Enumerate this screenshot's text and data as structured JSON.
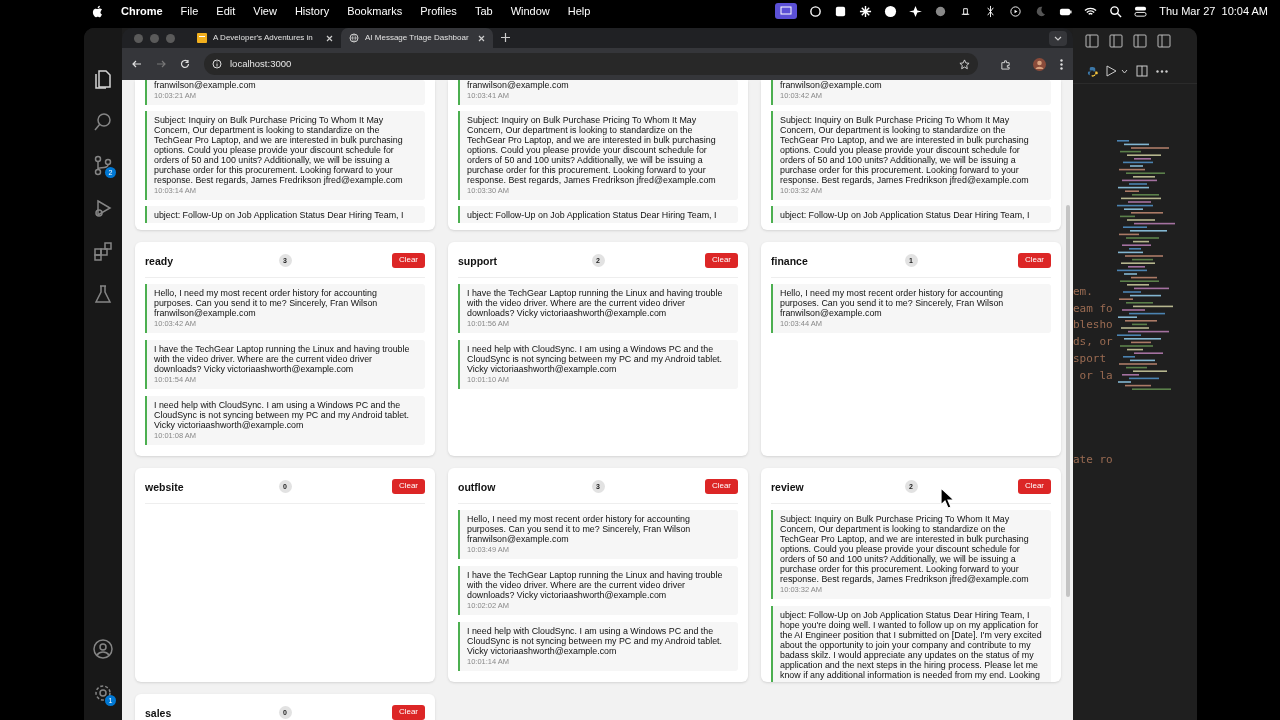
{
  "menubar": {
    "app": "Chrome",
    "menus": [
      "File",
      "Edit",
      "View",
      "History",
      "Bookmarks",
      "Profiles",
      "Tab",
      "Window",
      "Help"
    ],
    "clock": "Thu Mar 27  10:04 AM"
  },
  "vscode": {
    "source_control_badge": "2",
    "settings_badge": "1",
    "editor_lines": [
      "em.",
      "eam fo",
      "blesho",
      "ds, or",
      "sport",
      " or la"
    ],
    "editor_lines_lower": [
      "ate ro"
    ]
  },
  "browser": {
    "tabs": [
      {
        "title": "A Developer's Adventures in",
        "selected": false
      },
      {
        "title": "AI Message Triage Dashboar",
        "selected": true
      }
    ],
    "url": "localhost:3000"
  },
  "top_cards": [
    {
      "messages": [
        {
          "text": "franwilson@example.com",
          "time": "10:03:21 AM"
        },
        {
          "text": "Subject: Inquiry on Bulk Purchase Pricing To Whom It May Concern, Our department is looking to standardize on the TechGear Pro Laptop, and we are interested in bulk purchasing options. Could you please provide your discount schedule for orders of 50 and 100 units? Additionally, we will be issuing a purchase order for this procurement. Looking forward to your response. Best regards, James Fredrikson jfred@example.com",
          "time": "10:03:14 AM"
        },
        {
          "text": "ubject: Follow-Up on Job Application Status Dear Hiring Team, I"
        }
      ]
    },
    {
      "messages": [
        {
          "text": "franwilson@example.com",
          "time": "10:03:41 AM"
        },
        {
          "text": "Subject: Inquiry on Bulk Purchase Pricing To Whom It May Concern, Our department is looking to standardize on the TechGear Pro Laptop, and we are interested in bulk purchasing options. Could you please provide your discount schedule for orders of 50 and 100 units? Additionally, we will be issuing a purchase order for this procurement. Looking forward to your response. Best regards, James Fredrikson jfred@example.com",
          "time": "10:03:30 AM"
        },
        {
          "text": "ubject: Follow-Up on Job Application Status Dear Hiring Team, I"
        }
      ]
    },
    {
      "messages": [
        {
          "text": "franwilson@example.com",
          "time": "10:03:42 AM"
        },
        {
          "text": "Subject: Inquiry on Bulk Purchase Pricing To Whom It May Concern, Our department is looking to standardize on the TechGear Pro Laptop, and we are interested in bulk purchasing options. Could you please provide your discount schedule for orders of 50 and 100 units? Additionally, we will be issuing a purchase order for this procurement. Looking forward to your response. Best regards, James Fredrikson jfred@example.com",
          "time": "10:03:32 AM"
        },
        {
          "text": "ubject: Follow-Up on Job Application Status Dear Hiring Team, I"
        }
      ]
    }
  ],
  "cards": [
    {
      "title": "ready",
      "count": "3",
      "button": "Clear",
      "messages": [
        {
          "text": "Hello, I need my most recent order history for accounting purposes. Can you send it to me? Sincerely, Fran Wilson franwilson@example.com",
          "time": "10:03:42 AM"
        },
        {
          "text": "I have the TechGear Laptop running the Linux and having trouble with the video driver. Where are the current video driver downloads? Vicky victoriaashworth@example.com",
          "time": "10:01:54 AM"
        },
        {
          "text": "I need help with CloudSync. I am using a Windows PC and the CloudSync is not syncing between my PC and my Android tablet. Vicky victoriaashworth@example.com",
          "time": "10:01:08 AM"
        }
      ]
    },
    {
      "title": "support",
      "count": "2",
      "button": "Clear",
      "messages": [
        {
          "text": "I have the TechGear Laptop running the Linux and having trouble with the video driver. Where are the current video driver downloads? Vicky victoriaashworth@example.com",
          "time": "10:01:56 AM"
        },
        {
          "text": "I need help with CloudSync. I am using a Windows PC and the CloudSync is not syncing between my PC and my Android tablet. Vicky victoriaashworth@example.com",
          "time": "10:01:10 AM"
        }
      ]
    },
    {
      "title": "finance",
      "count": "1",
      "button": "Clear",
      "messages": [
        {
          "text": "Hello, I need my most recent order history for accounting purposes. Can you send it to me? Sincerely, Fran Wilson franwilson@example.com",
          "time": "10:03:44 AM"
        }
      ]
    },
    {
      "title": "website",
      "count": "0",
      "button": "Clear"
    },
    {
      "title": "outflow",
      "count": "3",
      "button": "Clear",
      "messages": [
        {
          "text": "Hello, I need my most recent order history for accounting purposes. Can you send it to me? Sincerely, Fran Wilson franwilson@example.com",
          "time": "10:03:49 AM"
        },
        {
          "text": "I have the TechGear Laptop running the Linux and having trouble with the video driver. Where are the current video driver downloads? Vicky victoriaashworth@example.com",
          "time": "10:02:02 AM"
        },
        {
          "text": "I need help with CloudSync. I am using a Windows PC and the CloudSync is not syncing between my PC and my Android tablet. Vicky victoriaashworth@example.com",
          "time": "10:01:14 AM"
        }
      ]
    },
    {
      "title": "review",
      "count": "2",
      "button": "Clear",
      "messages": [
        {
          "text": "Subject: Inquiry on Bulk Purchase Pricing To Whom It May Concern, Our department is looking to standardize on the TechGear Pro Laptop, and we are interested in bulk purchasing options. Could you please provide your discount schedule for orders of 50 and 100 units? Additionally, we will be issuing a purchase order for this procurement. Looking forward to your response. Best regards, James Fredrikson jfred@example.com",
          "time": "10:03:32 AM"
        },
        {
          "text": "ubject: Follow-Up on Job Application Status Dear Hiring Team, I hope you're doing well. I wanted to follow up on my application for the AI Engineer position that I submitted on [Date]. I'm very excited about the opportunity to join your company and contribute to my badass skilz. I would appreciate any updates on the status of my application and the next steps in the hiring process. Please let me know if any additional information is needed from my end. Looking"
        }
      ]
    },
    {
      "title": "sales",
      "count": "0",
      "button": "Clear"
    }
  ]
}
